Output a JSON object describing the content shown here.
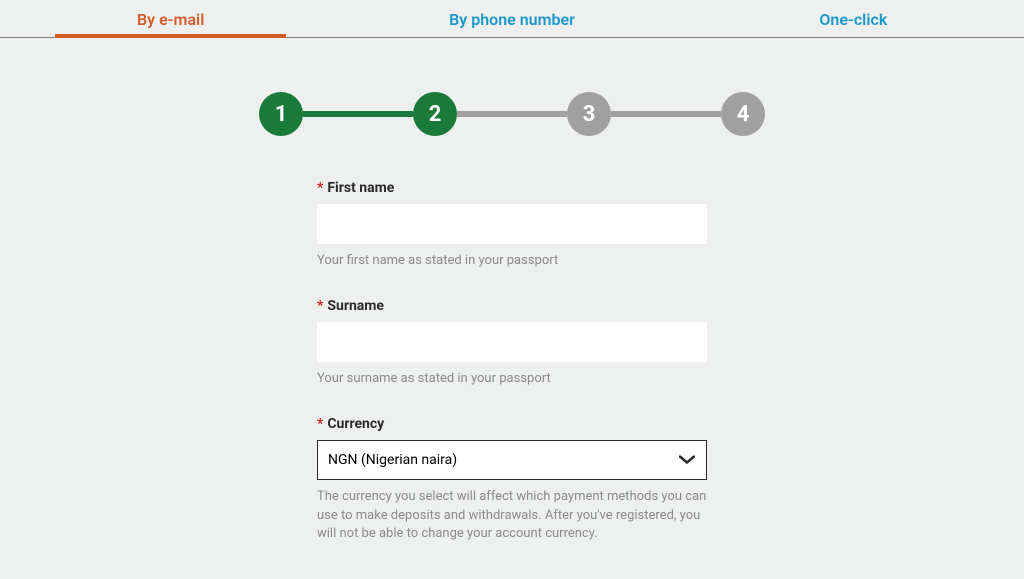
{
  "tabs": {
    "email": "By e-mail",
    "phone": "By phone number",
    "oneclick": "One-click"
  },
  "stepper": {
    "steps": [
      "1",
      "2",
      "3",
      "4"
    ],
    "current": 2
  },
  "form": {
    "first_name": {
      "label": "First name",
      "value": "",
      "helper": "Your first name as stated in your passport"
    },
    "surname": {
      "label": "Surname",
      "value": "",
      "helper": "Your surname as stated in your passport"
    },
    "currency": {
      "label": "Currency",
      "selected": "NGN (Nigerian naira)",
      "helper": "The currency you select will affect which payment methods you can use to make deposits and withdrawals. After you've registered, you will not be able to change your account currency."
    }
  },
  "required_marker": "*"
}
